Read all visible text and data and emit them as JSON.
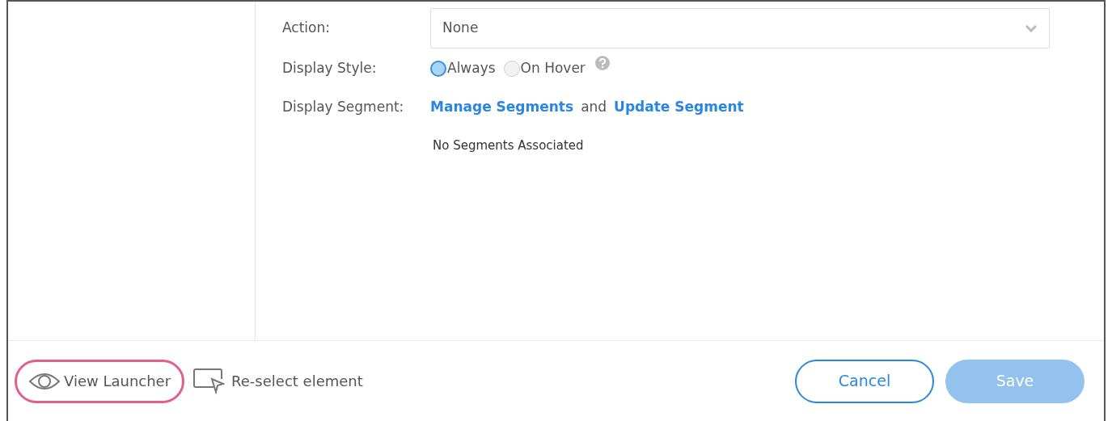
{
  "form": {
    "action": {
      "label": "Action:",
      "value": "None"
    },
    "display_style": {
      "label": "Display Style:",
      "options": [
        {
          "label": "Always",
          "selected": true
        },
        {
          "label": "On Hover",
          "selected": false
        }
      ]
    },
    "display_segment": {
      "label": "Display Segment:",
      "links": [
        "Manage Segments",
        "Update Segment"
      ],
      "joiner": "and",
      "note": "No Segments Associated"
    }
  },
  "footer": {
    "view_launcher": {
      "label": "View Launcher",
      "highlighted": true
    },
    "reselect": "Re-select element",
    "buttons": [
      {
        "label": "Cancel",
        "kind": "outline",
        "disabled": false
      },
      {
        "label": "Save",
        "kind": "primary",
        "disabled": true
      }
    ]
  }
}
